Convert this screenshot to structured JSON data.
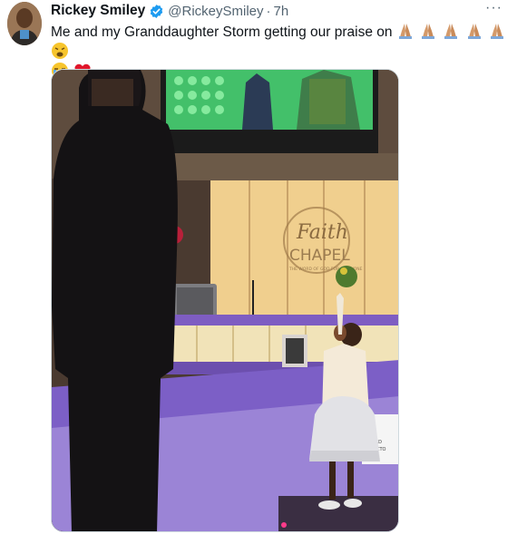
{
  "tweet": {
    "display_name": "Rickey Smiley",
    "handle": "@RickeySmiley",
    "separator": "·",
    "time": "7h",
    "more_label": "···",
    "text": "Me and my Granddaughter Storm getting our praise on",
    "emojis": [
      "folded-hands",
      "folded-hands",
      "folded-hands",
      "folded-hands",
      "folded-hands",
      "weary-face",
      "loudly-crying-face",
      "red-heart"
    ],
    "verified_icon": "verified-badge-icon",
    "verified_color": "#1d9bf0"
  },
  "media": {
    "sign_text_1": "Faith",
    "sign_text_2": "CHAPEL",
    "sign_text_3": "THE WORD OF GOD FOR EVERYONE",
    "board_text_1": "BOARD",
    "board_text_2": "DIRECTO"
  },
  "colors": {
    "stage_purple": "#8a6fc9",
    "carpet": "#9b84d6",
    "glow_panel": "#f3d9a6"
  }
}
